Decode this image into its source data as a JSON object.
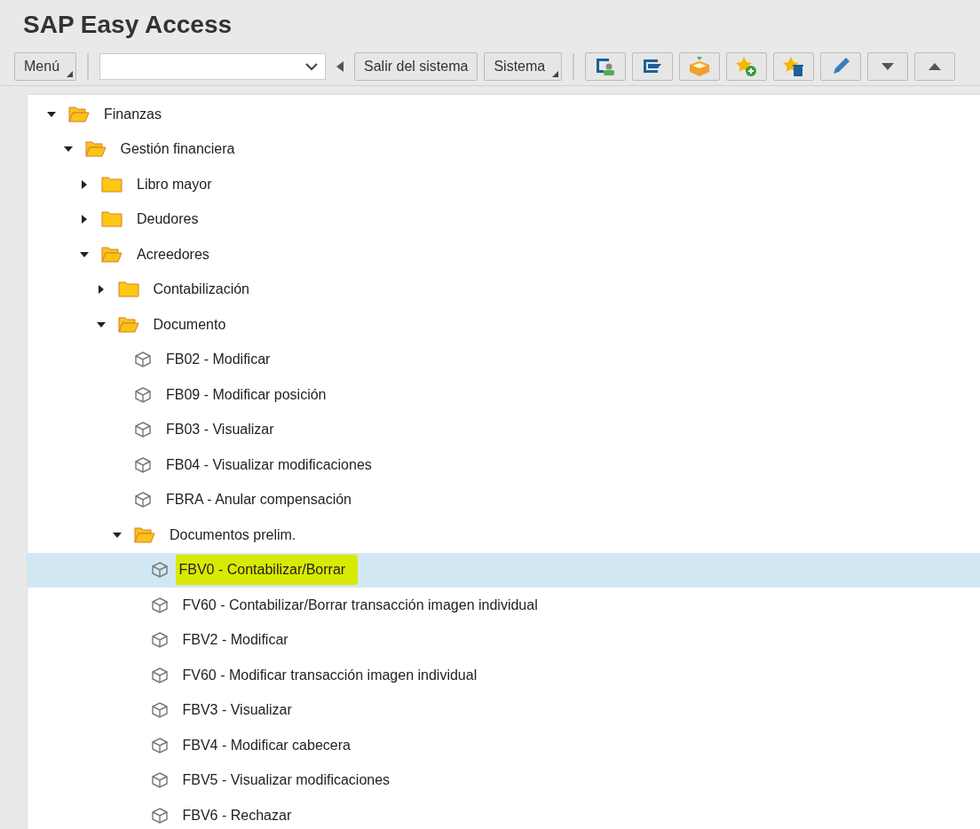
{
  "window": {
    "title": "SAP Easy Access"
  },
  "toolbar": {
    "menu_button": "Menú",
    "buttons": [
      "Salir del sistema"
    ],
    "system_button": "Sistema",
    "icon_buttons": [
      {
        "kind": "user-screen"
      },
      {
        "kind": "form"
      },
      {
        "kind": "box"
      },
      {
        "kind": "star-add"
      },
      {
        "kind": "star-delete"
      },
      {
        "kind": "pencil"
      },
      {
        "kind": "down"
      },
      {
        "kind": "up"
      }
    ]
  },
  "tree": [
    {
      "kind": "folder",
      "label": "Finanzas",
      "expanded": true,
      "selected": false,
      "children": [
        {
          "kind": "folder",
          "label": "Gestión financiera",
          "expanded": true,
          "selected": false,
          "children": [
            {
              "kind": "folder",
              "label": "Libro mayor",
              "expanded": false,
              "selected": false
            },
            {
              "kind": "folder",
              "label": "Deudores",
              "expanded": false,
              "selected": false
            },
            {
              "kind": "folder",
              "label": "Acreedores",
              "expanded": true,
              "selected": false,
              "children": [
                {
                  "kind": "folder",
                  "label": "Contabilización",
                  "expanded": false,
                  "selected": false
                },
                {
                  "kind": "folder",
                  "label": "Documento",
                  "expanded": true,
                  "selected": false,
                  "children": [
                    {
                      "kind": "transaction",
                      "label": "FB02 - Modificar",
                      "selected": false
                    },
                    {
                      "kind": "transaction",
                      "label": "FB09 - Modificar posición",
                      "selected": false
                    },
                    {
                      "kind": "transaction",
                      "label": "FB03 - Visualizar",
                      "selected": false
                    },
                    {
                      "kind": "transaction",
                      "label": "FB04 - Visualizar modificaciones",
                      "selected": false
                    },
                    {
                      "kind": "transaction",
                      "label": "FBRA - Anular compensación",
                      "selected": false
                    },
                    {
                      "kind": "folder",
                      "label": "Documentos prelim.",
                      "expanded": true,
                      "selected": false,
                      "children": [
                        {
                          "kind": "transaction",
                          "label": "FBV0 - Contabilizar/Borrar",
                          "selected": true,
                          "highlighted": true
                        },
                        {
                          "kind": "transaction",
                          "label": "FV60 - Contabilizar/Borrar transacción imagen individual",
                          "selected": false,
                          "highlighted": false
                        },
                        {
                          "kind": "transaction",
                          "label": "FBV2 - Modificar",
                          "selected": false,
                          "highlighted": false
                        },
                        {
                          "kind": "transaction",
                          "label": "FV60 - Modificar transacción imagen individual",
                          "selected": false,
                          "highlighted": false
                        },
                        {
                          "kind": "transaction",
                          "label": "FBV3 - Visualizar",
                          "selected": false,
                          "highlighted": false
                        },
                        {
                          "kind": "transaction",
                          "label": "FBV4 - Modificar cabecera",
                          "selected": false,
                          "highlighted": false
                        },
                        {
                          "kind": "transaction",
                          "label": "FBV5 - Visualizar modificaciones",
                          "selected": false,
                          "highlighted": false
                        },
                        {
                          "kind": "transaction",
                          "label": "FBV6 - Rechazar",
                          "selected": false,
                          "highlighted": false
                        }
                      ]
                    }
                  ]
                }
              ]
            }
          ]
        }
      ]
    }
  ]
}
